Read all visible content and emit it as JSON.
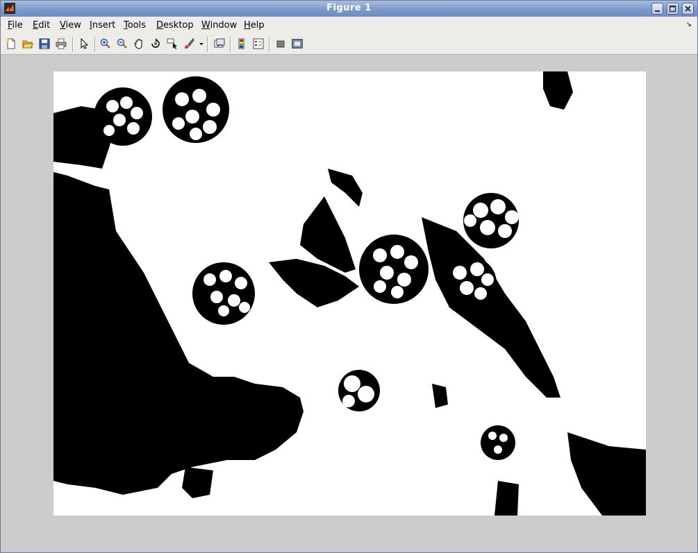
{
  "window": {
    "title": "Figure 1"
  },
  "menubar": {
    "items": [
      {
        "name": "file",
        "label": "File",
        "underline": "F",
        "rest": "ile"
      },
      {
        "name": "edit",
        "label": "Edit",
        "underline": "E",
        "rest": "dit"
      },
      {
        "name": "view",
        "label": "View",
        "underline": "V",
        "rest": "iew"
      },
      {
        "name": "insert",
        "label": "Insert",
        "underline": "I",
        "rest": "nsert"
      },
      {
        "name": "tools",
        "label": "Tools",
        "underline": "T",
        "rest": "ools"
      },
      {
        "name": "desktop",
        "label": "Desktop",
        "underline": "D",
        "rest": "esktop"
      },
      {
        "name": "window",
        "label": "Window",
        "underline": "W",
        "rest": "indow"
      },
      {
        "name": "help",
        "label": "Help",
        "underline": "H",
        "rest": "elp"
      }
    ]
  },
  "toolbar": {
    "icons": [
      "new-figure-icon",
      "open-file-icon",
      "save-icon",
      "print-icon",
      "edit-plot-icon",
      "zoom-in-icon",
      "zoom-out-icon",
      "pan-icon",
      "rotate-3d-icon",
      "data-cursor-icon",
      "brush-icon",
      "link-plot-icon",
      "colorbar-icon",
      "legend-icon",
      "hide-plot-tools-icon",
      "show-plot-tools-icon"
    ]
  },
  "colors": {
    "titlebar": "#7f9ccc",
    "menubar": "#edece9",
    "figure_bg": "#cccccc",
    "image_fg": "#000000",
    "image_bg": "#ffffff"
  }
}
